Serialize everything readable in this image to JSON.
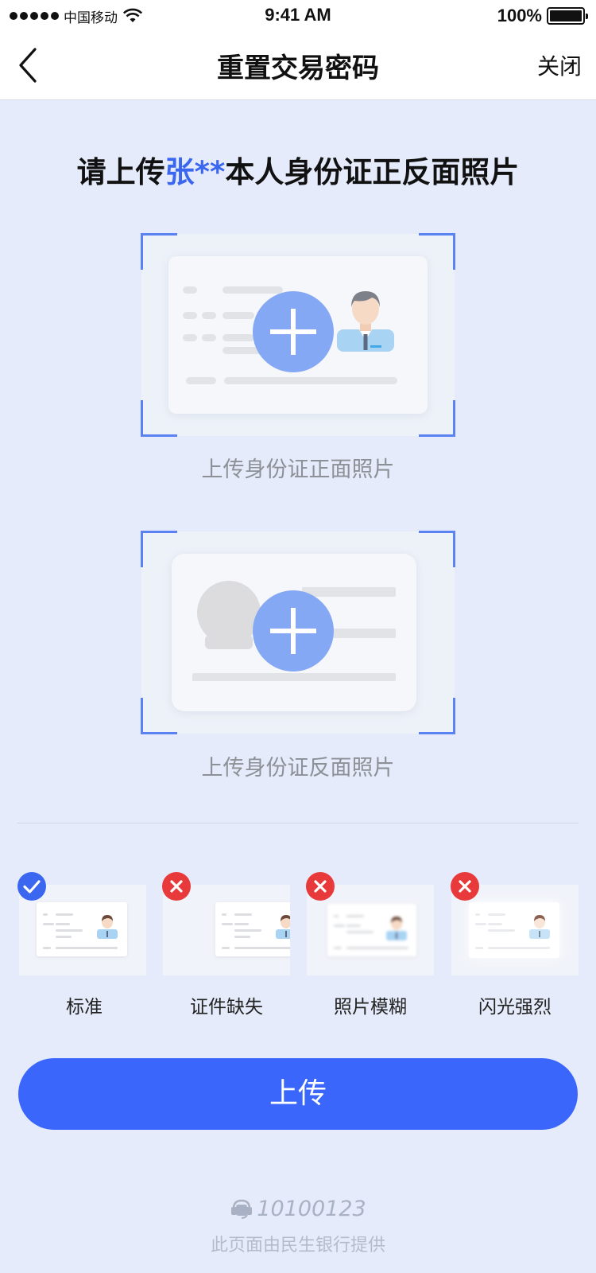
{
  "status_bar": {
    "carrier": "中国移动",
    "time": "9:41 AM",
    "battery": "100%"
  },
  "nav": {
    "title": "重置交易密码",
    "close_label": "关闭"
  },
  "heading": {
    "prefix": "请上传",
    "name": "张**",
    "suffix": "本人身份证正反面照片"
  },
  "upload_slots": [
    {
      "label": "上传身份证正面照片"
    },
    {
      "label": "上传身份证反面照片"
    }
  ],
  "examples": [
    {
      "label": "标准",
      "status": "ok"
    },
    {
      "label": "证件缺失",
      "status": "bad"
    },
    {
      "label": "照片模糊",
      "status": "bad"
    },
    {
      "label": "闪光强烈",
      "status": "bad"
    }
  ],
  "upload_button": {
    "label": "上传"
  },
  "footer": {
    "hotline": "10100123",
    "note": "此页面由民生银行提供"
  },
  "colors": {
    "accent": "#3a66f0",
    "button": "#3a66fb",
    "error": "#e83a3a",
    "background": "#e5ebfa"
  }
}
